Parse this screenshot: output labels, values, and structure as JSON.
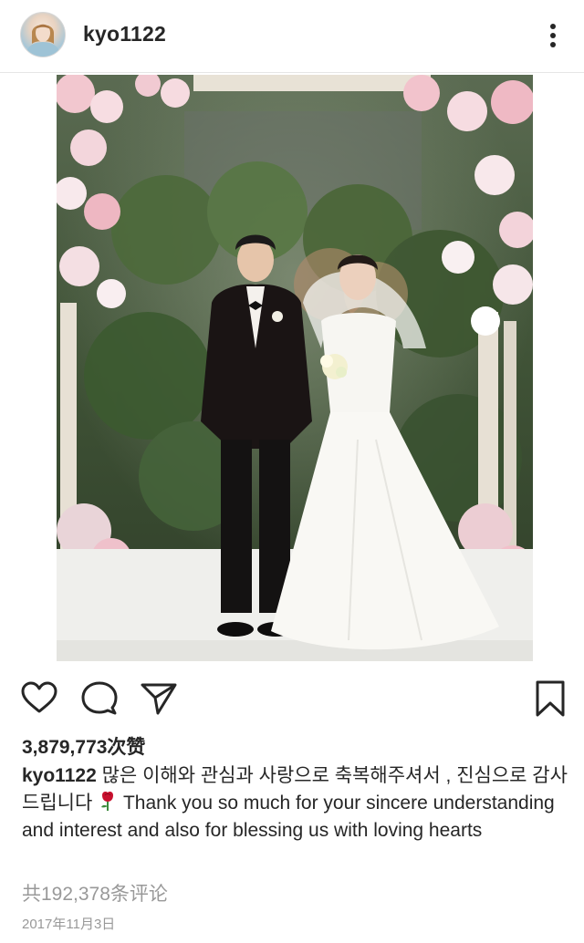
{
  "post": {
    "username": "kyo1122",
    "likes": "3,879,773次赞",
    "caption_user": "kyo1122",
    "caption_text": "많은 이해와 관심과 사랑으로 축복해주셔서 , 진심으로 감사드립니다",
    "caption_emoji": "🌹",
    "caption_english": "Thank you so much for your sincere understanding and interest and also for blessing us with loving hearts",
    "comments": "共192,378条评论",
    "date": "2017年11月3日"
  },
  "icons": {
    "more": "more-vertical-icon",
    "like": "heart-icon",
    "comment": "comment-icon",
    "share": "send-icon",
    "save": "bookmark-icon",
    "emoji": "rose-icon"
  },
  "colors": {
    "text": "#262626",
    "muted": "#999999",
    "divider": "#e6e6e6",
    "rose": "#c8102e"
  }
}
